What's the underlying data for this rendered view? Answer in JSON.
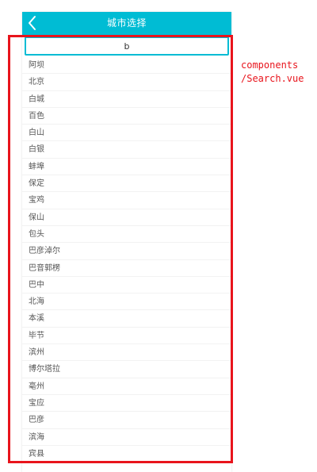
{
  "header": {
    "title": "城市选择",
    "back_icon": "chevron-left-icon",
    "background": "#00bcd4"
  },
  "search": {
    "value": "b",
    "border_color": "#00bcd4"
  },
  "cities": [
    "阿坝",
    "北京",
    "白城",
    "百色",
    "白山",
    "白银",
    "蚌埠",
    "保定",
    "宝鸡",
    "保山",
    "包头",
    "巴彦淖尔",
    "巴音郭楞",
    "巴中",
    "北海",
    "本溪",
    "毕节",
    "滨州",
    "博尔塔拉",
    "亳州",
    "宝应",
    "巴彦",
    "滨海",
    "宾县"
  ],
  "annotation": {
    "line1": "components",
    "line2": "/Search.vue",
    "color": "#e8141c"
  }
}
